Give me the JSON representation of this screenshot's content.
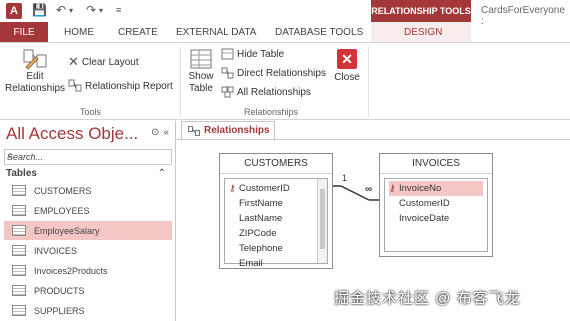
{
  "titlebar": {
    "app_icon": "A",
    "context_tools": "RELATIONSHIP TOOLS",
    "doc_title": "CardsForEveryone :"
  },
  "tabs": [
    "FILE",
    "HOME",
    "CREATE",
    "EXTERNAL DATA",
    "DATABASE TOOLS",
    "DESIGN"
  ],
  "ribbon": {
    "edit_relationships": "Edit\nRelationships",
    "clear_layout": "Clear Layout",
    "relationship_report": "Relationship Report",
    "tools_group": "Tools",
    "show_table": "Show\nTable",
    "hide_table": "Hide Table",
    "direct_relationships": "Direct Relationships",
    "all_relationships": "All Relationships",
    "relationships_group": "Relationships",
    "close": "Close"
  },
  "nav": {
    "title": "All Access Obje...",
    "search_placeholder": "Search...",
    "section": "Tables",
    "items": [
      "CUSTOMERS",
      "EMPLOYEES",
      "EmployeeSalary",
      "INVOICES",
      "Invoices2Products",
      "PRODUCTS",
      "SUPPLIERS"
    ],
    "selected_index": 2
  },
  "document": {
    "tab_label": "Relationships",
    "customers": {
      "title": "CUSTOMERS",
      "fields": [
        "CustomerID",
        "FirstName",
        "LastName",
        "ZIPCode",
        "Telephone",
        "Email"
      ]
    },
    "invoices": {
      "title": "INVOICES",
      "fields": [
        "InvoiceNo",
        "CustomerID",
        "InvoiceDate"
      ]
    },
    "rel_one": "1",
    "rel_many": "∞"
  },
  "watermark": "掘金技术社区 @ 布客飞龙",
  "colors": {
    "accent": "#a4373a",
    "selected": "#f4c6c6"
  }
}
